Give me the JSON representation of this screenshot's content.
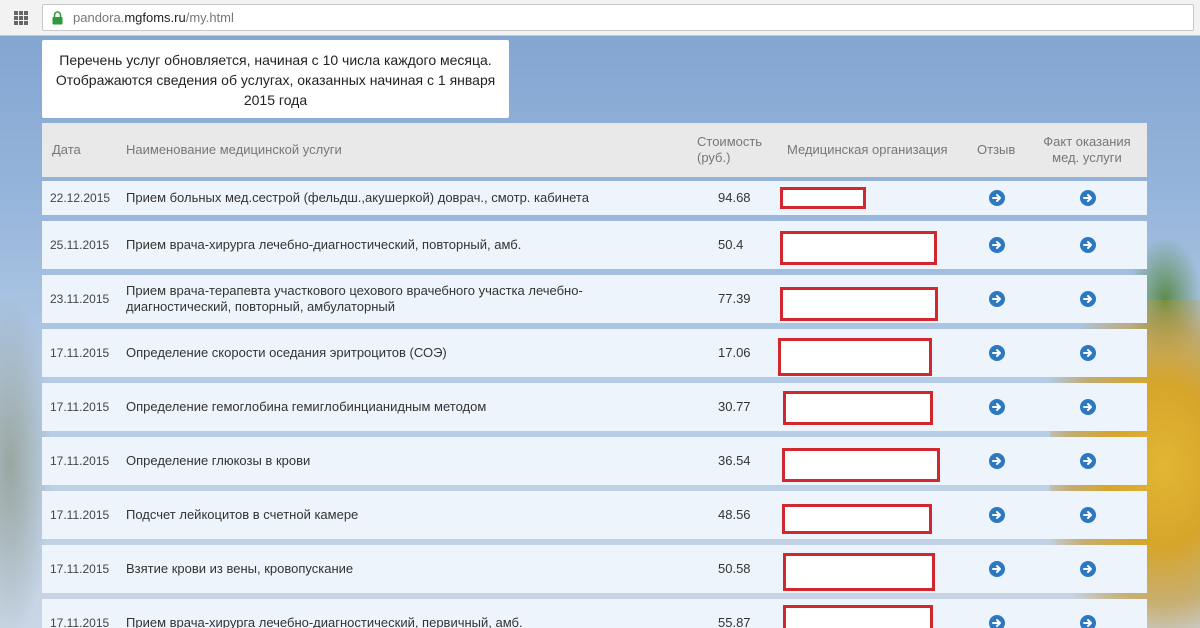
{
  "browser": {
    "url_prefix": "pandora.",
    "url_host": "mgfoms.ru",
    "url_path": "/my.html"
  },
  "notice": {
    "text": "Перечень услуг обновляется, начиная с 10 числа каждого месяца.  Отображаются сведения об услугах, оказанных начиная с 1 января 2015 года"
  },
  "table": {
    "headers": {
      "date": "Дата",
      "name": "Наименование медицинской услуги",
      "price_line1": "Стоимость",
      "price_line2": "(руб.)",
      "org": "Медицинская организация",
      "review": "Отзыв",
      "fact_line1": "Факт оказания",
      "fact_line2": "мед. услуги"
    },
    "rows": [
      {
        "date": "22.12.2015",
        "name": "Прием больных мед.сестрой (фельдш.,акушеркой) доврач., смотр. кабинета",
        "price": "94.68",
        "org_redacted": true
      },
      {
        "date": "25.11.2015",
        "name": "Прием врача-хирурга лечебно-диагностический, повторный, амб.",
        "price": "50.4",
        "org_redacted": true
      },
      {
        "date": "23.11.2015",
        "name": "Прием врача-терапевта участкового цехового врачебного участка лечебно-диагностический, повторный, амбулаторный",
        "price": "77.39",
        "org_redacted": true
      },
      {
        "date": "17.11.2015",
        "name": "Определение скорости оседания эритроцитов (СОЭ)",
        "price": "17.06",
        "org_redacted": true
      },
      {
        "date": "17.11.2015",
        "name": "Определение гемоглобина гемиглобинцианидным методом",
        "price": "30.77",
        "org_redacted": true
      },
      {
        "date": "17.11.2015",
        "name": "Определение глюкозы в крови",
        "price": "36.54",
        "org_redacted": true
      },
      {
        "date": "17.11.2015",
        "name": "Подсчет лейкоцитов в счетной камере",
        "price": "48.56",
        "org_redacted": true
      },
      {
        "date": "17.11.2015",
        "name": "Взятие крови из вены, кровопускание",
        "price": "50.58",
        "org_redacted": true
      },
      {
        "date": "17.11.2015",
        "name": "Прием врача-хирурга лечебно-диагностический, первичный, амб.",
        "price": "55.87",
        "org_redacted": true
      }
    ]
  },
  "icons": {
    "apps": "apps-grid-icon",
    "lock": "lock-icon",
    "row_action": "arrow-right-circle-icon"
  },
  "colors": {
    "header_bg": "#e9e9e9",
    "row_bg": "#eef4fb",
    "redaction": "#d0282e",
    "arrow": "#2c78c1"
  }
}
